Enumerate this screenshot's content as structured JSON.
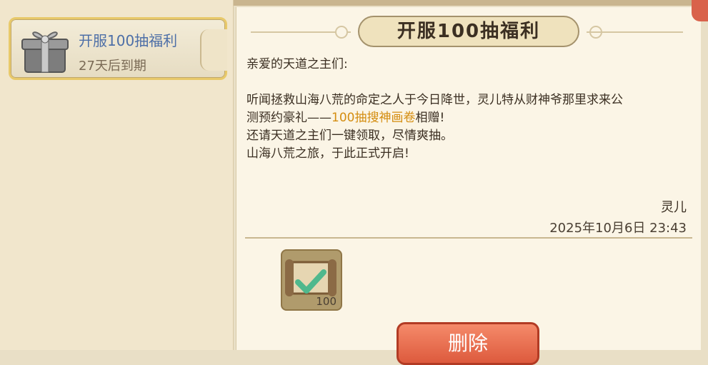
{
  "mail_list": {
    "items": [
      {
        "title": "开服100抽福利",
        "expire": "27天后到期"
      }
    ]
  },
  "detail": {
    "title": "开服100抽福利",
    "greeting": "亲爱的天道之主们:",
    "line1": "听闻拯救山海八荒的命定之人于今日降世，灵儿特从财神爷那里求来公",
    "line2_prefix": "测预约豪礼——",
    "line2_highlight": "100抽搜神画卷",
    "line2_suffix": "相赠!",
    "line3": "还请天道之主们一键领取，尽情爽抽。",
    "line4": "山海八荒之旅，于此正式开启!",
    "signature": "灵儿",
    "date": "2025年10月6日   23:43",
    "reward": {
      "count": "100",
      "icon": "scroll-icon"
    },
    "delete_label": "删除"
  },
  "colors": {
    "highlight": "#d48d10",
    "item_title": "#4d6fa7",
    "delete_button": "#e76b4c"
  }
}
